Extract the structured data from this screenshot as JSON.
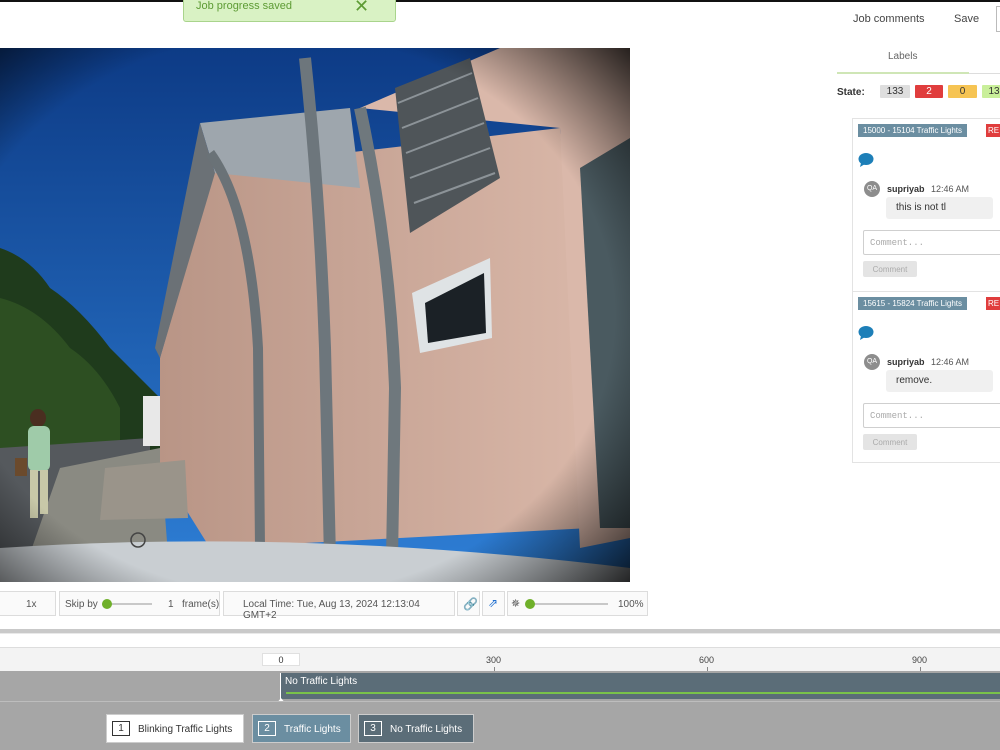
{
  "toast": {
    "message": "Job progress saved"
  },
  "header": {
    "job_comments": "Job comments",
    "save": "Save"
  },
  "toolbar": {
    "speed": "1x",
    "skip_label": "Skip by",
    "skip_value": "1",
    "skip_unit": "frame(s)",
    "local_time": "Local Time: Tue, Aug 13, 2024 12:13:04 GMT+2",
    "brightness": "100%"
  },
  "panel": {
    "tab_labels": "Labels",
    "state_label": "State:",
    "states": [
      {
        "value": "133",
        "color": "#dedede"
      },
      {
        "value": "2",
        "color": "#e03d3d"
      },
      {
        "value": "0",
        "color": "#f6c453"
      },
      {
        "value": "13",
        "color": "#c9ef9a"
      }
    ],
    "comments": [
      {
        "tag": "15000 - 15104 Traffic Lights",
        "badge": "RE",
        "avatar": "QA",
        "author": "supriyab",
        "time": "12:46 AM",
        "text": "this is not tl",
        "placeholder": "Comment...",
        "button": "Comment"
      },
      {
        "tag": "15615 - 15824 Traffic Lights",
        "badge": "RE",
        "avatar": "QA",
        "author": "supriyab",
        "time": "12:46 AM",
        "text": "remove.",
        "placeholder": "Comment...",
        "button": "Comment"
      }
    ]
  },
  "timeline": {
    "ticks": [
      "0",
      "300",
      "600",
      "900"
    ],
    "segment_label": "No Traffic Lights"
  },
  "labels": [
    {
      "key": "1",
      "name": "Blinking Traffic Lights",
      "bg": "#ffffff",
      "fg": "#333333"
    },
    {
      "key": "2",
      "name": "Traffic Lights",
      "bg": "#6b8ea1",
      "fg": "#ffffff"
    },
    {
      "key": "3",
      "name": "No Traffic Lights",
      "bg": "#5b6d78",
      "fg": "#ffffff"
    }
  ]
}
